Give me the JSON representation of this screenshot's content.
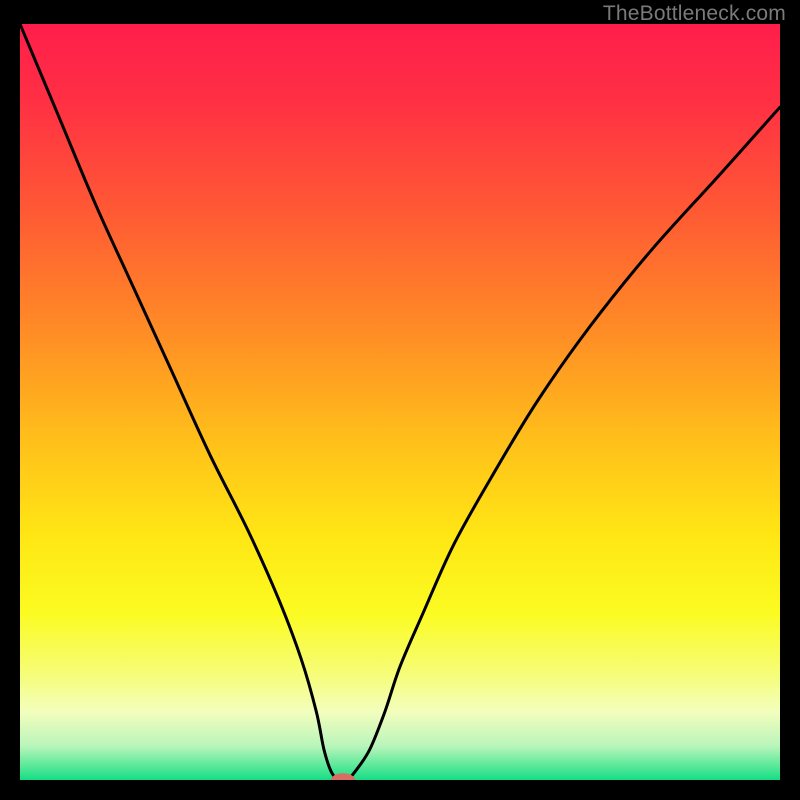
{
  "watermark": "TheBottleneck.com",
  "colors": {
    "background": "#000000",
    "watermark": "#7a7a7a",
    "curve": "#000000",
    "marker_fill": "#d96d62",
    "gradient_stops": [
      {
        "offset": 0.0,
        "color": "#ff1e4b"
      },
      {
        "offset": 0.1,
        "color": "#ff2f44"
      },
      {
        "offset": 0.25,
        "color": "#ff5a34"
      },
      {
        "offset": 0.4,
        "color": "#ff8a26"
      },
      {
        "offset": 0.55,
        "color": "#ffbf1a"
      },
      {
        "offset": 0.68,
        "color": "#ffe714"
      },
      {
        "offset": 0.78,
        "color": "#fbfb22"
      },
      {
        "offset": 0.86,
        "color": "#f6fd78"
      },
      {
        "offset": 0.91,
        "color": "#f3febd"
      },
      {
        "offset": 0.955,
        "color": "#b9f5bb"
      },
      {
        "offset": 0.985,
        "color": "#4ce795"
      },
      {
        "offset": 1.0,
        "color": "#16dd86"
      }
    ]
  },
  "chart_data": {
    "type": "line",
    "title": "",
    "xlabel": "",
    "ylabel": "",
    "xlim": [
      0,
      100
    ],
    "ylim": [
      0,
      100
    ],
    "grid": false,
    "legend": false,
    "series": [
      {
        "name": "bottleneck-curve",
        "x": [
          0,
          5,
          10,
          15,
          20,
          25,
          30,
          34,
          37,
          39,
          40,
          41,
          42,
          43,
          44,
          46,
          48,
          50,
          53,
          57,
          62,
          68,
          75,
          83,
          92,
          100
        ],
        "values": [
          100,
          88,
          76,
          65,
          54,
          43,
          33,
          24,
          16,
          9,
          4,
          1,
          0,
          0,
          1,
          4,
          9,
          15,
          22,
          31,
          40,
          50,
          60,
          70,
          80,
          89
        ]
      }
    ],
    "marker": {
      "x": 42.5,
      "y": 0,
      "rx": 1.6,
      "ry": 0.9
    }
  }
}
